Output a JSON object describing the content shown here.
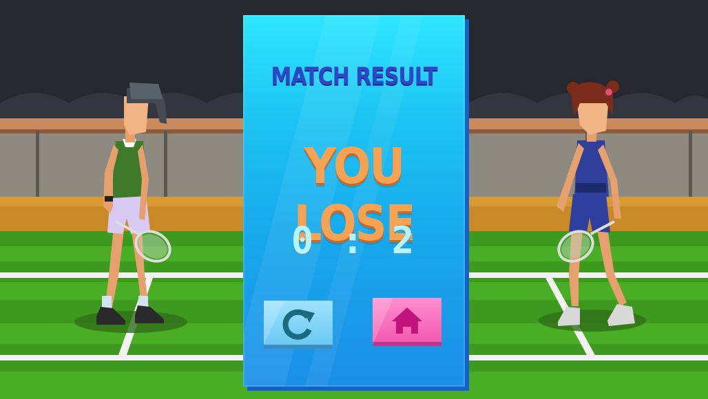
{
  "dialog": {
    "title": "MATCH RESULT",
    "result_text": "YOU LOSE",
    "score": "0 : 2"
  },
  "buttons": {
    "retry_icon": "restart-icon",
    "home_icon": "home-icon"
  },
  "colors": {
    "panel_top": "#2fe6ff",
    "panel_bottom": "#1b8fe8",
    "title": "#2c48c9",
    "result": "#f5a253",
    "score": "#b6f4ff",
    "retry_button": "#6cc9f2",
    "home_button": "#f25ab0",
    "court_green": "#3e9a1f"
  }
}
